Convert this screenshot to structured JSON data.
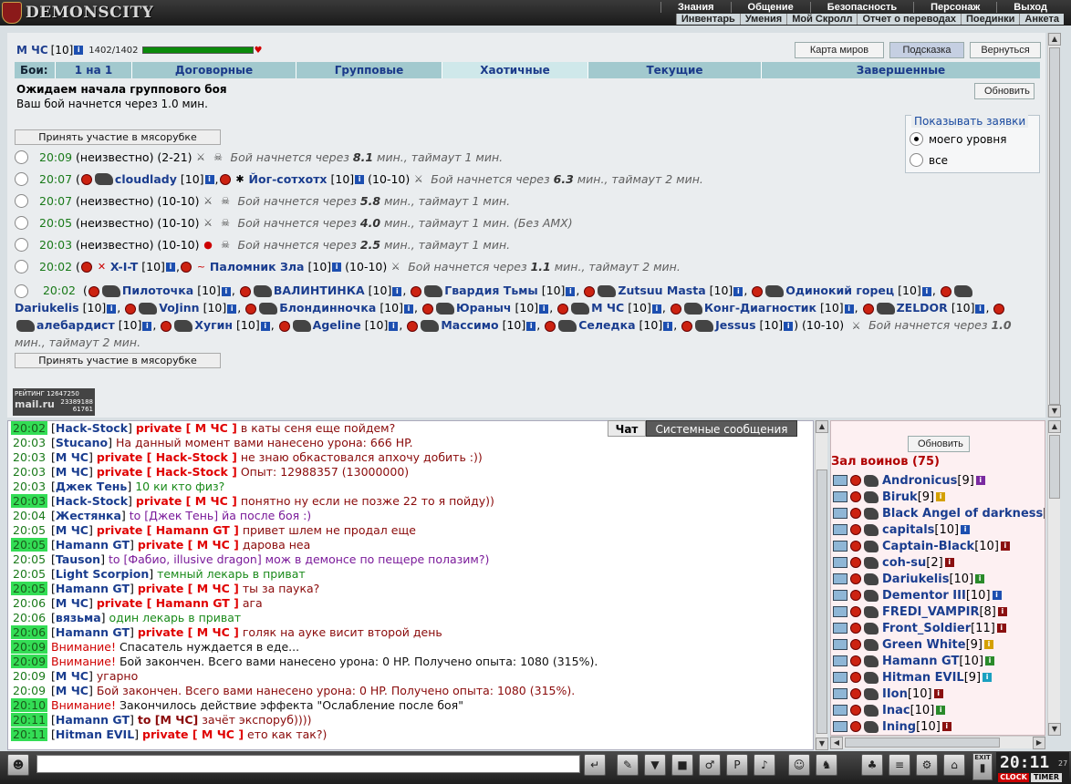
{
  "header": {
    "logo_text": "DEMONSCITY",
    "main_menu": [
      "Знания",
      "Общение",
      "Безопасность",
      "Персонаж",
      "Выход"
    ],
    "sub_menu": [
      "Инвентарь",
      "Умения",
      "Мой Скролл",
      "Отчет о переводах",
      "Поединки",
      "Анкета"
    ]
  },
  "hero": {
    "name": "М ЧС",
    "level": "[10]",
    "info": "i",
    "hp": "1402/1402",
    "hp_fraction": 1.0,
    "heart": "♥"
  },
  "top_buttons": {
    "map": "Карта миров",
    "hint": "Подсказка",
    "back": "Вернуться"
  },
  "battle_tabs": {
    "label": "Бои:",
    "tabs": [
      "1 на 1",
      "Договорные",
      "Групповые",
      "Хаотичные",
      "Текущие",
      "Завершенные"
    ],
    "active": "Хаотичные"
  },
  "waiting": {
    "heading": "Ожидаем начала группового боя",
    "sub": "Ваш бой начнется через 1.0 мин."
  },
  "refresh_label": "Обновить",
  "show": {
    "legend": "Показывать заявки",
    "opt1": "моего уровня",
    "opt2": "все"
  },
  "join_label": "Принять участие в мясорубке",
  "rows": [
    {
      "time": "20:09",
      "body": "(неизвестно) (2-21)",
      "note_pre": "Бой начнется через ",
      "note_val": "8.1",
      "note_post": " мин., таймаут 1 мин."
    },
    {
      "time": "20:07",
      "p1": "cloudlady",
      "lvl": "[10]",
      "p2": "Йог-сотхотх",
      "rng": "(10-10)",
      "note_pre": "Бой начнется через ",
      "note_val": "6.3",
      "note_post": " мин., таймаут 2 мин."
    },
    {
      "time": "20:07",
      "body": "(неизвестно) (10-10)",
      "note_pre": "Бой начнется через ",
      "note_val": "5.8",
      "note_post": " мин., таймаут 1 мин."
    },
    {
      "time": "20:05",
      "body": "(неизвестно) (10-10)",
      "note_pre": "Бой начнется через ",
      "note_val": "4.0",
      "note_post": " мин., таймаут 1 мин. (Без АМХ)"
    },
    {
      "time": "20:03",
      "body": "(неизвестно) (10-10)",
      "note_pre": "Бой начнется через ",
      "note_val": "2.5",
      "note_post": " мин., таймаут 1 мин."
    },
    {
      "time": "20:02",
      "p1": "X-I-T",
      "lvl": "[10]",
      "p2": "Паломник Зла",
      "rng": "(10-10)",
      "note_pre": "Бой начнется через ",
      "note_val": "1.1",
      "note_post": " мин., таймаут 2 мин."
    }
  ],
  "big_row": {
    "time": "20:02",
    "players": [
      "Пилоточка",
      "ВАЛИНТИНКА",
      "Гвардия Тьмы",
      "Zutsuu Masta",
      "Одинокий горец",
      "Dariukelis",
      "VoJinn",
      "Блондинночка",
      "Юраныч",
      "М ЧС",
      "Конг-Диагностик",
      "ZELDOR",
      "алебардист",
      "Хугин",
      "Ageline",
      "Массимо",
      "Селедка",
      "Jessus"
    ],
    "lvl": "[10]",
    "rng": "(10-10)",
    "note_pre": "Бой начнется через ",
    "note_val": "1.0",
    "note_post": " мин., таймаут 2 мин."
  },
  "rating": {
    "label": "РЕЙТИНГ",
    "n1": "12647250",
    "n2": "23389188",
    "n3": "61761",
    "brand": "mail.ru"
  },
  "chat_tabs": {
    "chat": "Чат",
    "system": "Системные сообщения"
  },
  "chat": [
    {
      "ts": "20:02",
      "hl": true,
      "nick": "Hack-Stock",
      "pv": "private [ М ЧС ]",
      "msg": " в каты сеня еще пойдем?"
    },
    {
      "ts": "20:03",
      "hl": false,
      "nick": "Stucano",
      "pv": "",
      "msg": " На данный момент вами нанесено урона: 666 HP."
    },
    {
      "ts": "20:03",
      "hl": false,
      "nick": "М ЧС",
      "pv": "private [ Hack-Stock ]",
      "msg": " не знаю обкастовался апхочу добить :))"
    },
    {
      "ts": "20:03",
      "hl": false,
      "nick": "М ЧС",
      "pv": "private [ Hack-Stock ]",
      "msg": " Опыт: 12988357 (13000000)"
    },
    {
      "ts": "20:03",
      "hl": false,
      "nick": "Джек Тень",
      "pv": "",
      "msg": " 10 ки кто физ?",
      "cls": "green"
    },
    {
      "ts": "20:03",
      "hl": true,
      "nick": "Hack-Stock",
      "pv": "private [ М ЧС ]",
      "msg": " понятно ну если не позже 22 то я пойду))"
    },
    {
      "ts": "20:04",
      "hl": false,
      "nick": "Жестянка",
      "pv": "",
      "msg": " to [Джек Тень] йа после боя :)",
      "cls": "purple"
    },
    {
      "ts": "20:05",
      "hl": false,
      "nick": "М ЧС",
      "pv": "private [ Hamann GT ]",
      "msg": " привет шлем не продал еще"
    },
    {
      "ts": "20:05",
      "hl": true,
      "nick": "Hamann GT",
      "pv": "private [ М ЧС ]",
      "msg": " дарова неа"
    },
    {
      "ts": "20:05",
      "hl": false,
      "nick": "Tauson",
      "pv": "",
      "msg": " to [Фабио, illusive dragon] мож в демонсе по пещере полазим?)",
      "cls": "purple"
    },
    {
      "ts": "20:05",
      "hl": false,
      "nick": "Light Scorpion",
      "pv": "",
      "msg": " темный лекарь в приват",
      "cls": "green"
    },
    {
      "ts": "20:05",
      "hl": true,
      "nick": "Hamann GT",
      "pv": "private [ М ЧС ]",
      "msg": " ты за паука?"
    },
    {
      "ts": "20:06",
      "hl": false,
      "nick": "М ЧС",
      "pv": "private [ Hamann GT ]",
      "msg": " ага"
    },
    {
      "ts": "20:06",
      "hl": false,
      "nick": "вязьма",
      "pv": "",
      "msg": " один лекарь в приват",
      "cls": "green"
    },
    {
      "ts": "20:06",
      "hl": true,
      "nick": "Hamann GT",
      "pv": "private [ М ЧС ]",
      "msg": " голяк на ауке висит второй день"
    },
    {
      "ts": "20:09",
      "hl": true,
      "warn": "Внимание!",
      "msg": " Спасатель нуждается в еде...",
      "cls": "black"
    },
    {
      "ts": "20:09",
      "hl": true,
      "warn": "Внимание!",
      "msg": " Бой закончен. Всего вами нанесено урона: 0 HP. Получено опыта: 1080 (315%).",
      "cls": "black"
    },
    {
      "ts": "20:09",
      "hl": false,
      "nick": "М ЧС",
      "pv": "",
      "msg": " угарно"
    },
    {
      "ts": "20:09",
      "hl": false,
      "nick": "М ЧС",
      "pv": "",
      "msg": " Бой закончен. Всего вами нанесено урона: 0 HP. Получено опыта: 1080 (315%)."
    },
    {
      "ts": "20:10",
      "hl": true,
      "warn": "Внимание!",
      "msg": " Закончилось действие эффекта \"Ослабление после боя\"",
      "cls": "black"
    },
    {
      "ts": "20:11",
      "hl": true,
      "nick": "Hamann GT",
      "pv": "to [М ЧС]",
      "msg": " зачёт экспорyб))))",
      "pvcls": "to"
    },
    {
      "ts": "20:11",
      "hl": true,
      "nick": "Hitman EVIL",
      "pv": "private [ М ЧС ]",
      "msg": " ето как так?)"
    }
  ],
  "warriors": {
    "refresh": "Обновить",
    "hall": "Зал воинов (75)",
    "list": [
      {
        "name": "Andronicus",
        "lvl": "[9]",
        "badge": "#7a2aa0"
      },
      {
        "name": "Biruk",
        "lvl": "[9]",
        "badge": "#d4a000"
      },
      {
        "name": "Black Angel of darkness",
        "lvl": "[",
        "badge": ""
      },
      {
        "name": "capitals",
        "lvl": "[10]",
        "badge": "#1d4fb0"
      },
      {
        "name": "Captain-Black",
        "lvl": "[10]",
        "badge": "#8a1010"
      },
      {
        "name": "coh-su",
        "lvl": "[2]",
        "badge": "#8a1010"
      },
      {
        "name": "Dariukelis",
        "lvl": "[10]",
        "badge": "#2a8a2a"
      },
      {
        "name": "Dementor III",
        "lvl": "[10]",
        "badge": "#1d4fb0"
      },
      {
        "name": "FREDI_VAMPIR",
        "lvl": "[8]",
        "badge": "#8a1010"
      },
      {
        "name": "Front_Soldier",
        "lvl": "[11]",
        "badge": "#8a1010"
      },
      {
        "name": "Green White",
        "lvl": "[9]",
        "badge": "#d4a000"
      },
      {
        "name": "Hamann GT",
        "lvl": "[10]",
        "badge": "#2a8a2a"
      },
      {
        "name": "Hitman EVIL",
        "lvl": "[9]",
        "badge": "#1aa0c0"
      },
      {
        "name": "IIon",
        "lvl": "[10]",
        "badge": "#8a1010"
      },
      {
        "name": "Inac",
        "lvl": "[10]",
        "badge": "#2a8a2a"
      },
      {
        "name": "Ining",
        "lvl": "[10]",
        "badge": "#8a1010"
      }
    ]
  },
  "bottom": {
    "clock": "20:11",
    "seconds": "27",
    "clock_btn": "CLOCK",
    "timer_btn": "TIMER",
    "exit": "EXIT"
  }
}
